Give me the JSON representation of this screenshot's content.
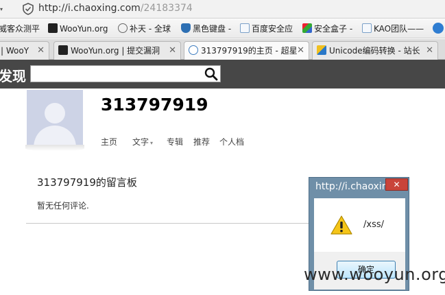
{
  "browser": {
    "address": {
      "url_prefix": "http://",
      "url_host": "i.chaoxing.com",
      "url_path": "/24183374"
    },
    "bookmarks": [
      {
        "label": "威客众测平",
        "icon": "bookmark-icon"
      },
      {
        "label": "WooYun.org",
        "icon": "wooyun-icon"
      },
      {
        "label": "补天 - 全球",
        "icon": "butian-icon"
      },
      {
        "label": "黑色键盘 -",
        "icon": "shield-icon"
      },
      {
        "label": "百度安全应",
        "icon": "page-icon"
      },
      {
        "label": "安全盒子 -",
        "icon": "feather-icon"
      },
      {
        "label": "KAO团队——",
        "icon": "page-icon"
      }
    ],
    "tabs": [
      {
        "label": "| WooY",
        "closable": true
      },
      {
        "label": "WooYun.org | 提交漏洞",
        "closable": true
      },
      {
        "label": "313797919的主页 - 超星",
        "closable": true,
        "active": true
      },
      {
        "label": "Unicode编码转换 - 站长",
        "closable": true
      }
    ]
  },
  "site": {
    "logo": "发现",
    "search": {
      "value": "",
      "placeholder": ""
    }
  },
  "profile": {
    "username": "313797919",
    "nav": [
      "主页",
      "文字",
      "专辑",
      "推荐",
      "个人档"
    ]
  },
  "board": {
    "title": "313797919的留言板",
    "empty_text": "暂无任何评论."
  },
  "alert": {
    "title": "http://i.chaoxing.com",
    "message": "/xss/",
    "ok_label": "确定",
    "close_label": "✕"
  },
  "watermark": "www.wooyun.org",
  "colors": {
    "site_header": "#474747",
    "avatar_bg": "#cdd3e6",
    "dialog_frame": "#6f8fa8",
    "close_red": "#c9443a"
  }
}
